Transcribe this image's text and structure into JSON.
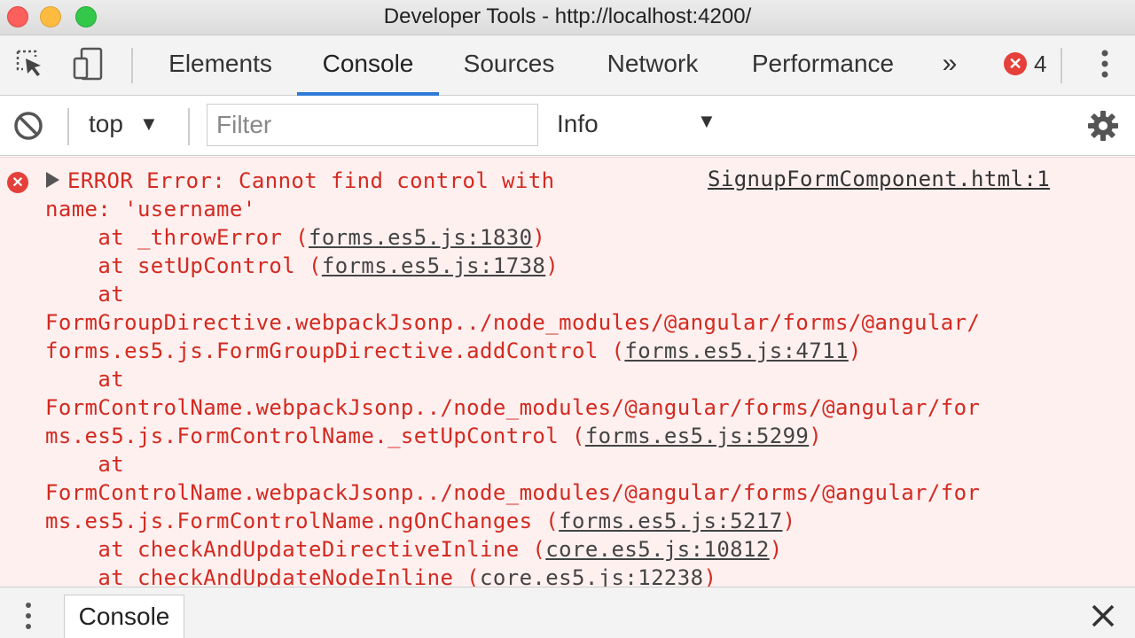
{
  "window": {
    "title": "Developer Tools - http://localhost:4200/"
  },
  "toolbar": {
    "icons": [
      "inspect-icon",
      "device-toggle-icon"
    ],
    "tabs": [
      "Elements",
      "Console",
      "Sources",
      "Network",
      "Performance"
    ],
    "more_tabs_label": "»",
    "error_count": "4",
    "active_tab": "Console"
  },
  "filterbar": {
    "context": "top",
    "filter_placeholder": "Filter",
    "filter_value": "",
    "level": "Info"
  },
  "console": {
    "message_prefix": "ERROR Error: Cannot find control with",
    "message_line2": "name: 'username'",
    "source": "SignupFormComponent.html:1",
    "stack": [
      {
        "pre": "    at _throwError (",
        "link": "forms.es5.js:1830",
        "post": ")"
      },
      {
        "pre": "    at setUpControl (",
        "link": "forms.es5.js:1738",
        "post": ")"
      },
      {
        "pre": "    at",
        "link": "",
        "post": ""
      },
      {
        "pre": "FormGroupDirective.webpackJsonp../node_modules/@angular/forms/@angular/",
        "link": "",
        "post": ""
      },
      {
        "pre": "forms.es5.js.FormGroupDirective.addControl (",
        "link": "forms.es5.js:4711",
        "post": ")"
      },
      {
        "pre": "    at",
        "link": "",
        "post": ""
      },
      {
        "pre": "FormControlName.webpackJsonp../node_modules/@angular/forms/@angular/for",
        "link": "",
        "post": ""
      },
      {
        "pre": "ms.es5.js.FormControlName._setUpControl (",
        "link": "forms.es5.js:5299",
        "post": ")"
      },
      {
        "pre": "    at",
        "link": "",
        "post": ""
      },
      {
        "pre": "FormControlName.webpackJsonp../node_modules/@angular/forms/@angular/for",
        "link": "",
        "post": ""
      },
      {
        "pre": "ms.es5.js.FormControlName.ngOnChanges (",
        "link": "forms.es5.js:5217",
        "post": ")"
      },
      {
        "pre": "    at checkAndUpdateDirectiveInline (",
        "link": "core.es5.js:10812",
        "post": ")"
      },
      {
        "pre": "    at checkAndUpdateNodeInline (",
        "link": "core.es5.js:12238",
        "post": ")"
      }
    ]
  },
  "drawer": {
    "tab": "Console"
  },
  "colors": {
    "accent": "#2f7ad8",
    "error": "#d32a20",
    "error_bg": "#fff0f0"
  }
}
